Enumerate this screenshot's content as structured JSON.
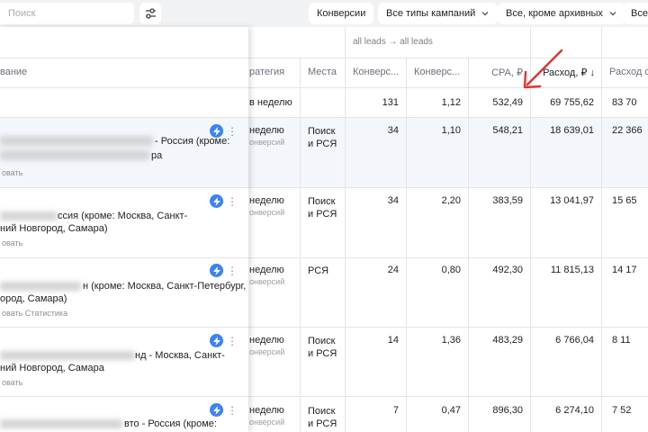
{
  "toolbar": {
    "search_placeholder": "Поиск",
    "chips": [
      "Конверсии",
      "Все типы кампаний",
      "Все, кроме архивных",
      "Все"
    ]
  },
  "table": {
    "group_header": "all leads → all leads",
    "columns": {
      "name": "вание",
      "strategy": "ратегия",
      "places": "Места",
      "conv1": "Конверс...",
      "conv2": "Конверс...",
      "cpa": "CPA, ₽",
      "spend_sorted": "Расход, ₽ ↓",
      "spend2": "Расход с"
    },
    "totals": {
      "label": "в неделю",
      "conversions": "131",
      "conv_rate": "1,12",
      "cpa": "532,49",
      "spend": "69 755,62",
      "spend2": "83 70"
    },
    "rows": [
      {
        "name_line1": "- Россия (кроме:",
        "name_line2": "ра",
        "links": "овать",
        "strategy": "неделю",
        "strategy_sub": "онверсий",
        "places": [
          "Поиск",
          "и РСЯ"
        ],
        "conversions": "34",
        "conv_rate": "1,10",
        "cpa": "548,21",
        "spend": "18 639,01",
        "spend2": "22 366"
      },
      {
        "name_line1": "ссия (кроме: Москва, Санкт-",
        "name_line2": "ний Новгород, Самара)",
        "links": "овать",
        "strategy": "неделю",
        "strategy_sub": "онверсий",
        "places": [
          "Поиск",
          "и РСЯ"
        ],
        "conversions": "34",
        "conv_rate": "2,20",
        "cpa": "383,59",
        "spend": "13 041,97",
        "spend2": "15 65"
      },
      {
        "name_line1": "н (кроме: Москва, Санкт-Петербург,",
        "name_line2": "ород, Самара)",
        "links": "овать   Статистика",
        "strategy": "неделю",
        "strategy_sub": "онверсий",
        "places": [
          "РСЯ"
        ],
        "conversions": "24",
        "conv_rate": "0,80",
        "cpa": "492,30",
        "spend": "11 815,13",
        "spend2": "14 17"
      },
      {
        "name_line1": "нд - Москва, Санкт-",
        "name_line2": "ний Новгород, Самара",
        "links": "овать",
        "strategy": "неделю",
        "strategy_sub": "онверсий",
        "places": [
          "Поиск",
          "и РСЯ"
        ],
        "conversions": "14",
        "conv_rate": "1,36",
        "cpa": "483,29",
        "spend": "6 766,04",
        "spend2": "8 11"
      },
      {
        "name_line1": "вто - Россия (кроме:",
        "name_line2": "",
        "links": "",
        "strategy": "неделю",
        "strategy_sub": "онверсий",
        "places": [
          "Поиск",
          "и РСЯ"
        ],
        "conversions": "7",
        "conv_rate": "0,47",
        "cpa": "896,30",
        "spend": "6 274,10",
        "spend2": "7 52"
      }
    ]
  },
  "annotation": {
    "arrow_color": "#e5322d"
  },
  "colors": {
    "accent_blue": "#3d82f5",
    "toolbar_bg": "#f1f2f4",
    "highlight_row": "#f3f6fb"
  }
}
